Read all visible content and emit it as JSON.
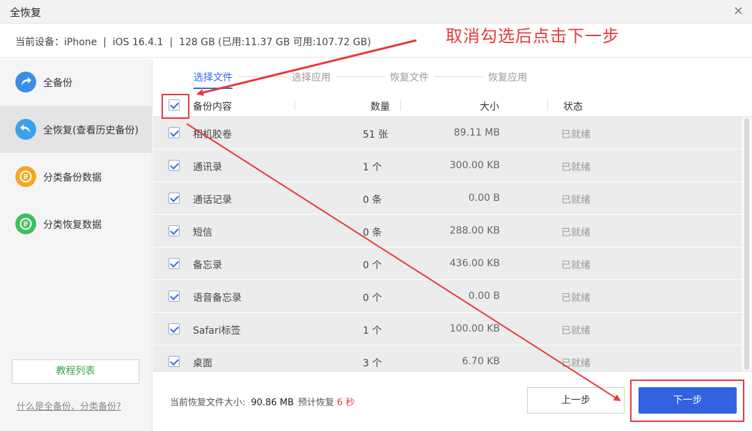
{
  "window": {
    "title": "全恢复",
    "close_glyph": "×"
  },
  "device": {
    "info": "当前设备：iPhone  |  iOS 16.4.1  |  128 GB (已用:11.37 GB 可用:107.72 GB)"
  },
  "annotation": {
    "text": "取消勾选后点击下一步",
    "color": "#e8383d"
  },
  "sidebar": {
    "items": [
      {
        "label": "全备份",
        "icon": "backup-arrow-icon",
        "color": "#3b8ee8",
        "active": false
      },
      {
        "label": "全恢复(查看历史备份)",
        "icon": "restore-arrow-icon",
        "color": "#3aa2e8",
        "active": true
      },
      {
        "label": "分类备份数据",
        "icon": "category-backup-icon",
        "color": "#f5a623",
        "active": false
      },
      {
        "label": "分类恢复数据",
        "icon": "category-restore-icon",
        "color": "#3fbf5f",
        "active": false
      }
    ],
    "tutorial_button": "教程列表",
    "help_link": "什么是全备份、分类备份?"
  },
  "steps": {
    "items": [
      "选择文件",
      "选择应用",
      "恢复文件",
      "恢复应用"
    ],
    "active_index": 0
  },
  "table": {
    "headers": {
      "name": "备份内容",
      "count": "数量",
      "size": "大小",
      "status": "状态"
    },
    "rows": [
      {
        "name": "相机胶卷",
        "count": "51 张",
        "size": "89.11 MB",
        "status": "已就绪",
        "checked": true
      },
      {
        "name": "通讯录",
        "count": "1 个",
        "size": "300.00 KB",
        "status": "已就绪",
        "checked": true
      },
      {
        "name": "通话记录",
        "count": "0 条",
        "size": "0.00 B",
        "status": "已就绪",
        "checked": true
      },
      {
        "name": "短信",
        "count": "0 条",
        "size": "288.00 KB",
        "status": "已就绪",
        "checked": true
      },
      {
        "name": "备忘录",
        "count": "0 个",
        "size": "436.00 KB",
        "status": "已就绪",
        "checked": true
      },
      {
        "name": "语音备忘录",
        "count": "0 个",
        "size": "0.00 B",
        "status": "已就绪",
        "checked": true
      },
      {
        "name": "Safari标签",
        "count": "1 个",
        "size": "100.00 KB",
        "status": "已就绪",
        "checked": true
      },
      {
        "name": "桌面",
        "count": "3 个",
        "size": "6.70 KB",
        "status": "已就绪",
        "checked": true
      }
    ]
  },
  "footer": {
    "size_label": "当前恢复文件大小:",
    "size_value": "90.86 MB",
    "time_label": "预计恢复",
    "time_value": "6 秒",
    "prev_button": "上一步",
    "next_button": "下一步"
  },
  "colors": {
    "accent": "#3262e0",
    "annotation_red": "#e8383d"
  }
}
